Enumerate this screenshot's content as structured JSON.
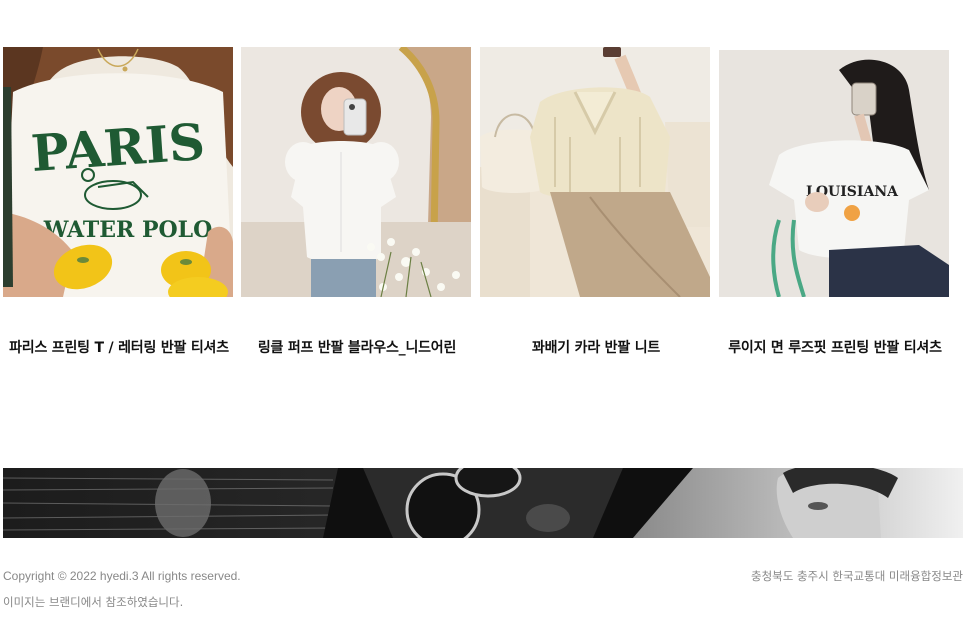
{
  "products": [
    {
      "title": "파리스 프린팅 T / 레터링 반팔 티셔츠",
      "image": {
        "text_line1": "PARIS",
        "text_line2": "WATER POLO"
      }
    },
    {
      "title": "링클 퍼프 반팔 블라우스_니드어린"
    },
    {
      "title": "꽈배기 카라 반팔 니트"
    },
    {
      "title": "루이지 면 루즈핏 프린팅 반팔 티셔츠",
      "image": {
        "text": "LOUISIANA"
      }
    }
  ],
  "footer": {
    "copyright": "Copyright © 2022 hyedi.3 All rights reserved.",
    "image_note": "이미지는 브랜디에서 참조하였습니다.",
    "address": "충청북도 충주시 한국교통대 미래융합정보관"
  },
  "colors": {
    "green_print": "#1f5a33",
    "lemon": "#f2c418",
    "footer_text": "#888888"
  }
}
